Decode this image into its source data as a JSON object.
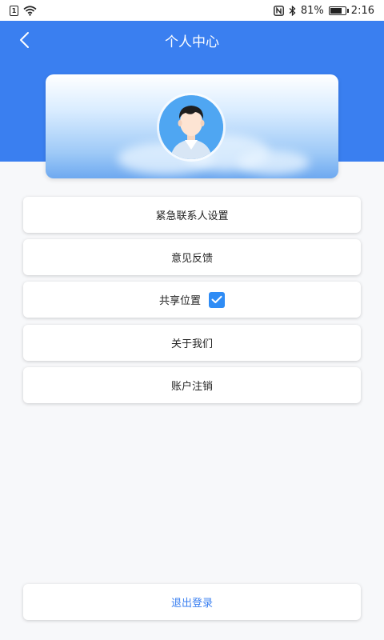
{
  "status_bar": {
    "sim": "1",
    "battery_text": "81%",
    "time": "2:16",
    "battery_level": 0.81
  },
  "header": {
    "title": "个人中心"
  },
  "menu": {
    "emergency_contact": "紧急联系人设置",
    "feedback": "意见反馈",
    "share_location": "共享位置",
    "share_location_checked": true,
    "about_us": "关于我们",
    "account_cancel": "账户注销"
  },
  "logout_label": "退出登录",
  "colors": {
    "primary": "#3a7ff0",
    "checkbox": "#2f8cf5",
    "background": "#f7f8fa"
  }
}
